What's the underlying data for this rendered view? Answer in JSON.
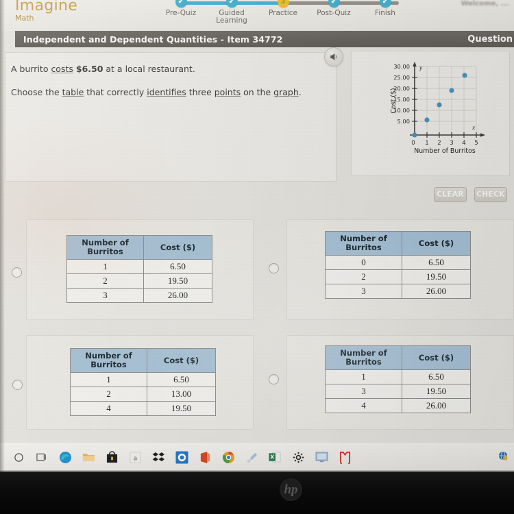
{
  "app": {
    "brand_name": "Imagine",
    "brand_sub": "Math",
    "top_right_faded": "Welcome, ...",
    "item_title": "Independent and Dependent Quantities - Item 34772",
    "question_label": "Question"
  },
  "progress": {
    "steps": [
      {
        "label": "Pre-Quiz",
        "state": "done",
        "glyph": "✔"
      },
      {
        "label": "Guided Learning",
        "state": "done",
        "glyph": "✔"
      },
      {
        "label": "Practice",
        "state": "current",
        "glyph": "3"
      },
      {
        "label": "Post-Quiz",
        "state": "done",
        "glyph": "✔"
      },
      {
        "label": "Finish",
        "state": "done",
        "glyph": "✔"
      }
    ]
  },
  "prompt": {
    "line1_a": "A burrito ",
    "line1_underline": "costs",
    "line1_b": " ",
    "line1_money": "$6.50",
    "line1_c": " at a local restaurant.",
    "line2_a": "Choose the ",
    "line2_u1": "table",
    "line2_b": " that correctly ",
    "line2_u2": "identifies",
    "line2_c": " three ",
    "line2_u3": "points",
    "line2_d": " on the ",
    "line2_u4": "graph",
    "line2_e": "."
  },
  "audio_button": {
    "icon": "speaker-icon"
  },
  "buttons": {
    "clear_label": "CLEAR",
    "check_label": "CHECK"
  },
  "chart_data": {
    "type": "scatter",
    "title": "",
    "xlabel": "Number of Burritos",
    "ylabel": "Cost ($)",
    "x_ticks": [
      "0",
      "1",
      "2",
      "3",
      "4",
      "5"
    ],
    "y_ticks": [
      "5.00",
      "10.00",
      "15.00",
      "20.00",
      "25.00",
      "30.00"
    ],
    "xlim": [
      0,
      5
    ],
    "ylim": [
      0,
      30
    ],
    "grid": true,
    "axis_label_x": "x",
    "axis_label_y": "y",
    "point_color": "#4a93bf",
    "points": [
      {
        "x": 0,
        "y": 0
      },
      {
        "x": 1,
        "y": 6.5
      },
      {
        "x": 2,
        "y": 13.0
      },
      {
        "x": 3,
        "y": 19.5
      },
      {
        "x": 4,
        "y": 26.0
      }
    ]
  },
  "choices": [
    {
      "id": "A",
      "headers": [
        "Number of Burritos",
        "Cost ($)"
      ],
      "rows": [
        [
          "1",
          "6.50"
        ],
        [
          "2",
          "19.50"
        ],
        [
          "3",
          "26.00"
        ]
      ]
    },
    {
      "id": "B",
      "headers": [
        "Number of Burritos",
        "Cost ($)"
      ],
      "rows": [
        [
          "0",
          "6.50"
        ],
        [
          "2",
          "19.50"
        ],
        [
          "3",
          "26.00"
        ]
      ]
    },
    {
      "id": "C",
      "headers": [
        "Number of Burritos",
        "Cost ($)"
      ],
      "rows": [
        [
          "1",
          "6.50"
        ],
        [
          "2",
          "13.00"
        ],
        [
          "4",
          "19.50"
        ]
      ]
    },
    {
      "id": "D",
      "headers": [
        "Number of Burritos",
        "Cost ($)"
      ],
      "rows": [
        [
          "1",
          "6.50"
        ],
        [
          "3",
          "19.50"
        ],
        [
          "4",
          "26.00"
        ]
      ]
    }
  ],
  "table_header_lines": {
    "l1": "Number of",
    "l2": "Burritos",
    "cost": "Cost ($)"
  },
  "taskbar": {
    "icons": [
      {
        "name": "search-icon",
        "glyph": "○",
        "color": "#3a3a3a"
      },
      {
        "name": "task-view-icon",
        "glyph": "▣",
        "color": "#3a3a3a"
      },
      {
        "name": "edge-browser-icon",
        "glyph": "◔",
        "color": "#1a8fd1"
      },
      {
        "name": "file-explorer-icon",
        "glyph": "▬",
        "color": "#e2ae4e"
      },
      {
        "name": "microsoft-store-icon",
        "glyph": "■",
        "color": "#2b2b2b"
      },
      {
        "name": "amazon-app-icon",
        "glyph": "a",
        "color": "#555555"
      },
      {
        "name": "dropbox-icon",
        "glyph": "❖",
        "color": "#111111"
      },
      {
        "name": "outlook-icon",
        "glyph": "O",
        "color": "#ffffff"
      },
      {
        "name": "office-icon",
        "glyph": "◠",
        "color": "#d8481f"
      },
      {
        "name": "chrome-browser-icon",
        "glyph": "◉",
        "color": "#e8a018"
      },
      {
        "name": "paint-icon",
        "glyph": "✒",
        "color": "#8fa8c8"
      },
      {
        "name": "excel-icon",
        "glyph": "X",
        "color": "#ffffff"
      },
      {
        "name": "settings-gear-icon",
        "glyph": "⚙",
        "color": "#2a2a2a"
      },
      {
        "name": "powerpoint-icon",
        "glyph": "▤",
        "color": "#7fa8cc"
      },
      {
        "name": "opera-gx-icon",
        "glyph": "♥",
        "color": "#d03a3a"
      }
    ],
    "tray_icon": "network-globe-icon"
  },
  "device": {
    "logo_text": "hp"
  }
}
